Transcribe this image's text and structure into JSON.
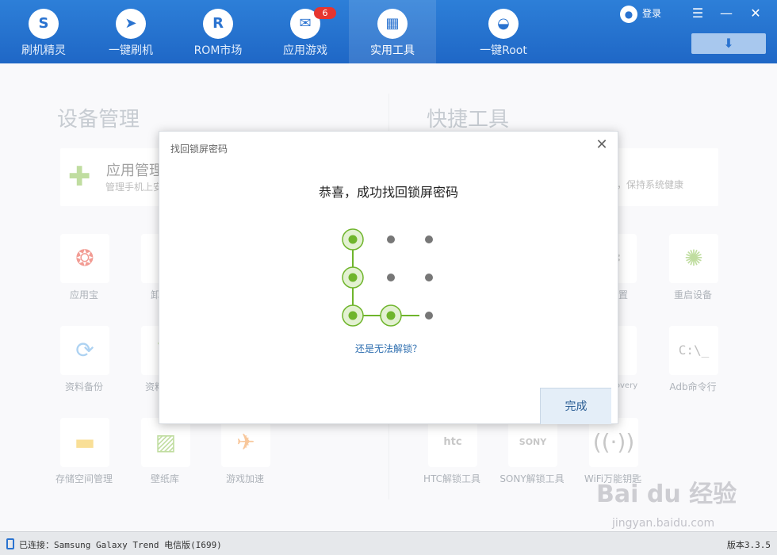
{
  "nav": {
    "items": [
      {
        "label": "刷机精灵",
        "icon": "shield-s-icon"
      },
      {
        "label": "一键刷机",
        "icon": "cursor-arrow-icon"
      },
      {
        "label": "ROM市场",
        "icon": "r-logo-icon"
      },
      {
        "label": "应用游戏",
        "icon": "mail-icon",
        "badge": "6"
      },
      {
        "label": "实用工具",
        "icon": "grid-icon",
        "active": true
      },
      {
        "label": "一键Root",
        "icon": "android-icon"
      }
    ],
    "login_label": "登录"
  },
  "left_section": {
    "title": "设备管理",
    "app_card": {
      "title": "应用管理",
      "sub": "管理手机上安"
    },
    "tiles": [
      {
        "label": "应用宝"
      },
      {
        "label": "卸载预"
      },
      {
        "label": "资料备份"
      },
      {
        "label": "资料"
      },
      {
        "label": "存储空间管理"
      },
      {
        "label": "壁纸库"
      },
      {
        "label": "游戏加速"
      }
    ]
  },
  "right_section": {
    "title": "快捷工具",
    "card_sub": "，保持系统健康",
    "tiles": [
      {
        "label": "设置"
      },
      {
        "label": "重启设备"
      },
      {
        "label": "overy"
      },
      {
        "label": "Adb命令行",
        "glyph": "C:\\_"
      },
      {
        "label": "HTC解锁工具",
        "glyph": "htc"
      },
      {
        "label": "SONY解锁工具",
        "glyph": "SONY"
      },
      {
        "label": "WiFi万能钥匙"
      }
    ]
  },
  "dialog": {
    "title": "找回锁屏密码",
    "message": "恭喜，成功找回锁屏密码",
    "link": "还是无法解锁？",
    "done_label": "完成",
    "pattern_selected": [
      1,
      4,
      7,
      8
    ]
  },
  "status": {
    "connected": "已连接：Samsung Galaxy Trend 电信版(I699)",
    "version": "版本3.3.5"
  },
  "watermark": {
    "text": "Bai du 经验",
    "sub": "jingyan.baidu.com"
  },
  "colors": {
    "nav_bg": "#2270cc",
    "pattern_green": "#6fb52c",
    "link": "#2f6fb0"
  }
}
